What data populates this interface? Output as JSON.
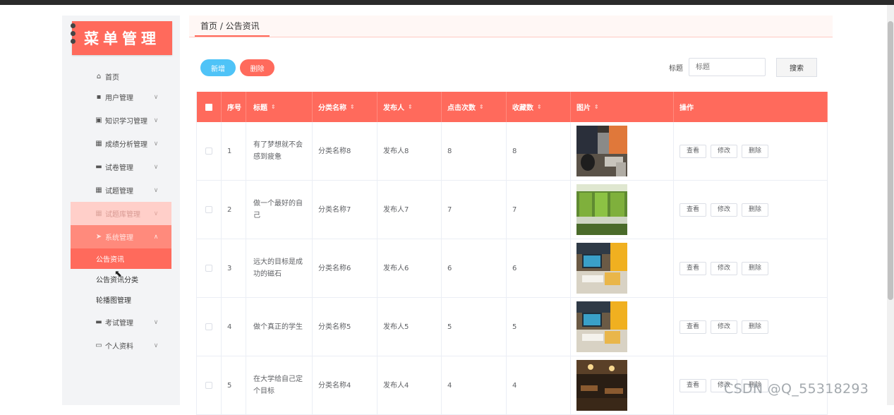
{
  "app": {
    "logo_text": "菜单管理"
  },
  "sidebar": {
    "items": [
      {
        "label": "首页",
        "icon": "home-icon",
        "glyph": "⌂",
        "chevron": ""
      },
      {
        "label": "用户管理",
        "icon": "user-icon",
        "glyph": "▪",
        "chevron": "∨"
      },
      {
        "label": "知识学习管理",
        "icon": "book-icon",
        "glyph": "▣",
        "chevron": "∨"
      },
      {
        "label": "成绩分析管理",
        "icon": "grid-icon",
        "glyph": "▦",
        "chevron": "∨"
      },
      {
        "label": "试卷管理",
        "icon": "paper-icon",
        "glyph": "▬",
        "chevron": "∨"
      },
      {
        "label": "试题管理",
        "icon": "grid-icon",
        "glyph": "▦",
        "chevron": "∨"
      },
      {
        "label": "试题库管理",
        "icon": "grid-icon",
        "glyph": "▦",
        "chevron": "∨"
      },
      {
        "label": "系统管理",
        "icon": "send-icon",
        "glyph": "➤",
        "chevron": "∧"
      }
    ],
    "sub_items": [
      {
        "label": "公告资讯"
      },
      {
        "label": "公告资讯分类"
      },
      {
        "label": "轮播图管理"
      }
    ],
    "bottom_items": [
      {
        "label": "考试管理",
        "icon": "paper-icon",
        "glyph": "▬",
        "chevron": "∨"
      },
      {
        "label": "个人资料",
        "icon": "profile-icon",
        "glyph": "▭",
        "chevron": "∨"
      }
    ]
  },
  "breadcrumb": "首页 / 公告资讯",
  "toolbar": {
    "add_label": "新增",
    "delete_label": "删除"
  },
  "search": {
    "label": "标题",
    "placeholder": "标题",
    "button_label": "搜索"
  },
  "table": {
    "columns": [
      "序号",
      "标题",
      "分类名称",
      "发布人",
      "点击次数",
      "收藏数",
      "图片",
      "操作"
    ],
    "sortable_mark": "⇕",
    "rows": [
      {
        "index": "1",
        "title": "有了梦想就不会感到疲惫",
        "category": "分类名称8",
        "publisher": "发布人8",
        "clicks": "8",
        "favorites": "8",
        "image": "study-room-photo"
      },
      {
        "index": "2",
        "title": "做一个最好的自己",
        "category": "分类名称7",
        "publisher": "发布人7",
        "clicks": "7",
        "favorites": "7",
        "image": "green-desks-photo"
      },
      {
        "index": "3",
        "title": "远大的目标是成功的磁石",
        "category": "分类名称6",
        "publisher": "发布人6",
        "clicks": "6",
        "favorites": "6",
        "image": "desk-monitor-photo"
      },
      {
        "index": "4",
        "title": "做个真正的学生",
        "category": "分类名称5",
        "publisher": "发布人5",
        "clicks": "5",
        "favorites": "5",
        "image": "desk-monitor-photo"
      },
      {
        "index": "5",
        "title": "在大学给自己定个目标",
        "category": "分类名称4",
        "publisher": "发布人4",
        "clicks": "4",
        "favorites": "4",
        "image": "cafe-photo"
      }
    ],
    "actions": [
      "查看",
      "修改",
      "删除"
    ]
  },
  "watermark": "CSDN @Q_55318293"
}
